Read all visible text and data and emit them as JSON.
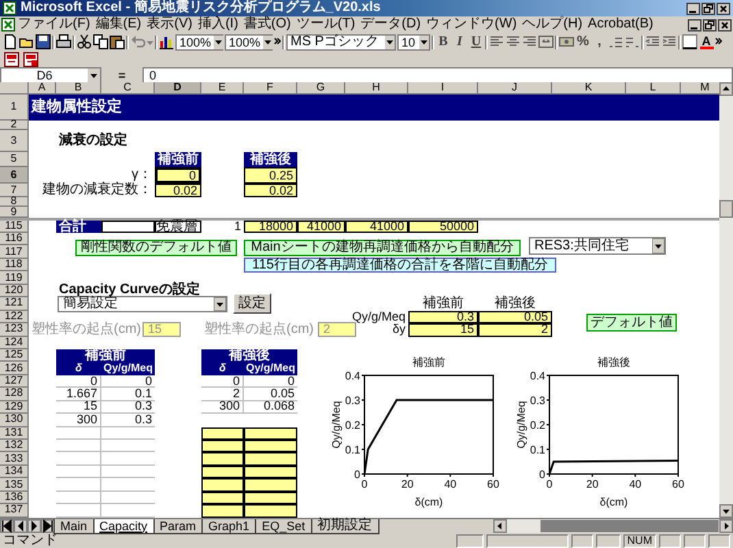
{
  "window": {
    "title": "Microsoft Excel - 簡易地震リスク分析プログラム_V20.xls"
  },
  "menu": [
    "ファイル(F)",
    "編集(E)",
    "表示(V)",
    "挿入(I)",
    "書式(O)",
    "ツール(T)",
    "データ(D)",
    "ウィンドウ(W)",
    "ヘルプ(H)",
    "Acrobat(B)"
  ],
  "toolbar": {
    "zoom": [
      "100%",
      "100%"
    ],
    "font": "MS Pゴシック",
    "size": "10",
    "style_buttons": [
      "B",
      "I",
      "U"
    ],
    "number_buttons": [
      "%",
      ","
    ],
    "font_color": "A"
  },
  "formula_bar": {
    "name_box": "D6",
    "equals": "=",
    "value": "0"
  },
  "columns": [
    {
      "label": "A",
      "selected": false
    },
    {
      "label": "B",
      "selected": false
    },
    {
      "label": "C",
      "selected": false
    },
    {
      "label": "D",
      "selected": true
    },
    {
      "label": "E",
      "selected": false
    },
    {
      "label": "F",
      "selected": false
    },
    {
      "label": "G",
      "selected": false
    },
    {
      "label": "H",
      "selected": false
    },
    {
      "label": "I",
      "selected": false
    },
    {
      "label": "J",
      "selected": false
    },
    {
      "label": "K",
      "selected": false
    },
    {
      "label": "L",
      "selected": false
    },
    {
      "label": "M",
      "selected": false
    }
  ],
  "rows": [
    {
      "label": "1",
      "selected": false
    },
    {
      "label": "2",
      "selected": false
    },
    {
      "label": "3",
      "selected": false
    },
    {
      "label": "5",
      "selected": false
    },
    {
      "label": "6",
      "selected": true
    },
    {
      "label": "7",
      "selected": false
    },
    {
      "label": "8",
      "selected": false
    },
    {
      "label": "9",
      "selected": false
    },
    {
      "label": "115",
      "selected": false
    },
    {
      "label": "116",
      "selected": false
    },
    {
      "label": "117",
      "selected": false
    },
    {
      "label": "118",
      "selected": false
    },
    {
      "label": "119",
      "selected": false
    },
    {
      "label": "120",
      "selected": false
    },
    {
      "label": "121",
      "selected": false
    },
    {
      "label": "122",
      "selected": false
    },
    {
      "label": "123",
      "selected": false
    },
    {
      "label": "124",
      "selected": false
    },
    {
      "label": "125",
      "selected": false
    },
    {
      "label": "126",
      "selected": false
    },
    {
      "label": "127",
      "selected": false
    },
    {
      "label": "128",
      "selected": false
    },
    {
      "label": "129",
      "selected": false
    },
    {
      "label": "130",
      "selected": false
    },
    {
      "label": "131",
      "selected": false
    },
    {
      "label": "132",
      "selected": false
    },
    {
      "label": "133",
      "selected": false
    },
    {
      "label": "134",
      "selected": false
    },
    {
      "label": "135",
      "selected": false
    },
    {
      "label": "136",
      "selected": false
    },
    {
      "label": "137",
      "selected": false
    }
  ],
  "sheet": {
    "title": "建物属性設定",
    "damping": {
      "heading": "減衰の設定",
      "before": "補強前",
      "after": "補強後",
      "rows": [
        {
          "label": "γ：",
          "before": "0",
          "after": "0.25"
        },
        {
          "label": "建物の減衰定数：",
          "before": "0.02",
          "after": "0.02"
        }
      ]
    },
    "total_row": {
      "label": "合計",
      "floor": "免震層",
      "count": "1",
      "values": [
        "18000",
        "41000",
        "41000",
        "50000"
      ]
    },
    "stiffness_default_button": "剛性関数のデフォルト値",
    "auto_from_main_button": "Mainシートの建物再調達価格から自動配分",
    "use_dropdown": "RES3:共同住宅",
    "auto_total_button": "115行目の各再調達価格の合計を各階に自動配分",
    "capacity": {
      "heading": "Capacity Curveの設定",
      "mode_dropdown": "簡易設定",
      "set_button": "設定",
      "start_fields": [
        {
          "label": "塑性率の起点(cm)",
          "value": "15",
          "disabled": true
        },
        {
          "label": "塑性率の起点(cm)",
          "value": "2",
          "disabled": true
        }
      ],
      "params": {
        "before": "補強前",
        "after": "補強後",
        "rows": [
          {
            "label": "Qy/g/Meq",
            "before": "0.3",
            "after": "0.05"
          },
          {
            "label": "δy",
            "before": "15",
            "after": "2"
          }
        ]
      },
      "default_button": "デフォルト値",
      "tables": [
        {
          "title": "補強前",
          "columns": [
            "δ",
            "Qy/g/Meq"
          ],
          "rows": [
            [
              "0",
              "0"
            ],
            [
              "1.667",
              "0.1"
            ],
            [
              "15",
              "0.3"
            ],
            [
              "300",
              "0.3"
            ]
          ],
          "editable": false
        },
        {
          "title": "補強後",
          "columns": [
            "δ",
            "Qy/g/Meq"
          ],
          "rows": [
            [
              "0",
              "0"
            ],
            [
              "2",
              "0.05"
            ],
            [
              "300",
              "0.068"
            ]
          ],
          "editable": true
        }
      ],
      "charts": [
        {
          "chart_data": {
            "type": "line",
            "title": "補強前",
            "xlabel": "δ(cm)",
            "ylabel": "Qy/g/Meq",
            "x": [
              0,
              1.667,
              15,
              60
            ],
            "series": [
              {
                "color": "#000000",
                "values": [
                  0,
                  0.1,
                  0.3,
                  0.3
                ]
              }
            ],
            "xlim": [
              0,
              60
            ],
            "ylim": [
              0,
              0.4
            ],
            "xticks": [
              0,
              20,
              40,
              60
            ],
            "yticks": [
              0,
              0.1,
              0.2,
              0.3,
              0.4
            ]
          }
        },
        {
          "chart_data": {
            "type": "line",
            "title": "補強後",
            "xlabel": "δ(cm)",
            "ylabel": "Qy/g/Meq",
            "x": [
              0,
              2,
              60
            ],
            "series": [
              {
                "color": "#000000",
                "values": [
                  0,
                  0.05,
                  0.054
                ]
              }
            ],
            "xlim": [
              0,
              60
            ],
            "ylim": [
              0,
              0.4
            ],
            "xticks": [
              0,
              20,
              40,
              60
            ],
            "yticks": [
              0,
              0.1,
              0.2,
              0.3,
              0.4
            ]
          }
        }
      ]
    }
  },
  "sheet_tabs": [
    {
      "label": "Main",
      "selected": false
    },
    {
      "label": "Capacity",
      "selected": true
    },
    {
      "label": "Param",
      "selected": false
    },
    {
      "label": "Graph1",
      "selected": false
    },
    {
      "label": "EQ_Set",
      "selected": false
    },
    {
      "label": "初期設定",
      "selected": false
    }
  ],
  "status_bar": {
    "mode": "コマンド",
    "num": "NUM"
  }
}
